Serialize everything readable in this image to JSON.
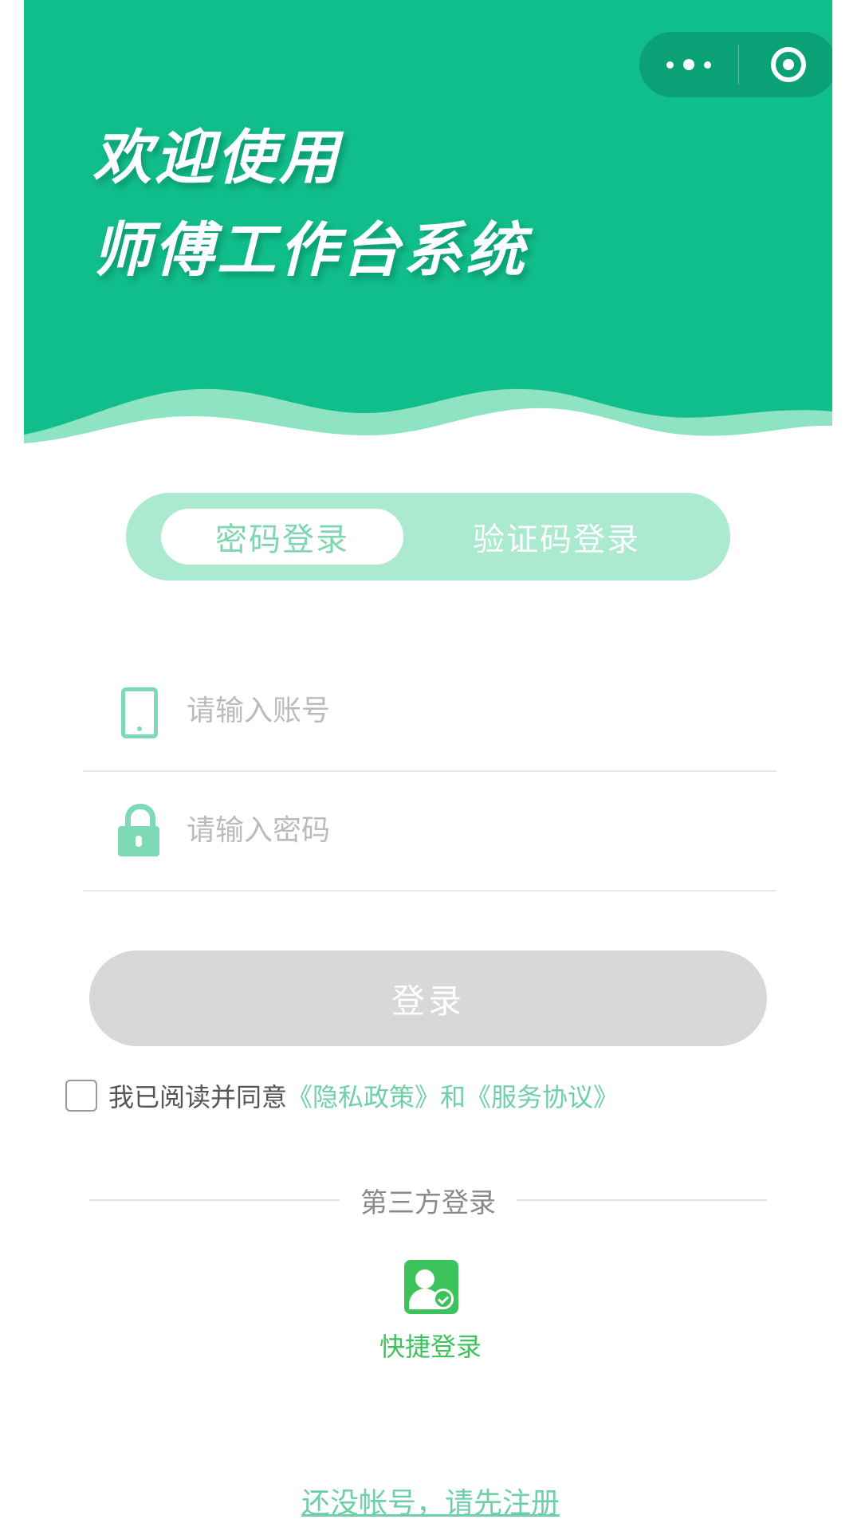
{
  "hero": {
    "title_line1": "欢迎使用",
    "title_line2": "师傅工作台系统"
  },
  "capsule": {
    "more_icon": "ellipsis-icon",
    "close_icon": "target-close-icon"
  },
  "tabs": [
    {
      "label": "密码登录",
      "active": true
    },
    {
      "label": "验证码登录",
      "active": false
    }
  ],
  "fields": {
    "account": {
      "placeholder": "请输入账号",
      "value": "",
      "icon": "phone-icon"
    },
    "password": {
      "placeholder": "请输入密码",
      "value": "",
      "icon": "lock-icon"
    }
  },
  "login_button": {
    "label": "登录"
  },
  "agreement": {
    "checked": false,
    "prefix": "我已阅读并同意",
    "privacy_link": "《隐私政策》",
    "and": "和",
    "service_link": "《服务协议》"
  },
  "third_party": {
    "title": "第三方登录",
    "quick_login_label": "快捷登录",
    "quick_login_icon": "user-check-icon"
  },
  "register": {
    "label": "还没帐号，请先注册"
  },
  "colors": {
    "primary_green": "#10be8c",
    "tab_bg": "#abe9d0",
    "accent_light": "#7ed9b6",
    "link_green": "#6fcfa8",
    "quick_green": "#3dc35c",
    "disabled_button": "#d8d8d8"
  }
}
